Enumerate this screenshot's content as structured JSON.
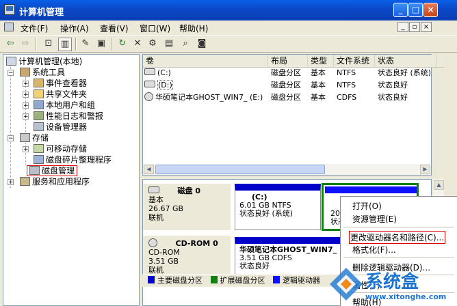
{
  "window": {
    "title": "计算机管理",
    "min": "_",
    "max": "□",
    "close": "×"
  },
  "menu": [
    "文件(F)",
    "操作(A)",
    "查看(V)",
    "窗口(W)",
    "帮助(H)"
  ],
  "mdi": {
    "min": "_",
    "restore": "▫",
    "close": "×"
  },
  "tree": {
    "root": "计算机管理(本地)",
    "system_tools": "系统工具",
    "event_viewer": "事件查看器",
    "shared_folders": "共享文件夹",
    "local_users": "本地用户和组",
    "perf_logs": "性能日志和警报",
    "device_manager": "设备管理器",
    "storage": "存储",
    "removable": "可移动存储",
    "defrag": "磁盘碎片整理程序",
    "disk_mgmt": "磁盘管理",
    "services": "服务和应用程序"
  },
  "list": {
    "headers": [
      "卷",
      "布局",
      "类型",
      "文件系统",
      "状态"
    ],
    "rows": [
      {
        "vol": "(C:)",
        "layout": "磁盘分区",
        "type": "基本",
        "fs": "NTFS",
        "status": "状态良好 (系统)"
      },
      {
        "vol": "(D:)",
        "layout": "磁盘分区",
        "type": "基本",
        "fs": "NTFS",
        "status": "状态良好"
      },
      {
        "vol": "华硕笔记本GHOST_WIN7_ (E:)",
        "layout": "磁盘分区",
        "type": "基本",
        "fs": "CDFS",
        "status": "状态良好"
      }
    ]
  },
  "disks": [
    {
      "name": "磁盘 0",
      "kind": "基本",
      "size": "26.67 GB",
      "state": "联机",
      "parts": [
        {
          "label": "(C:)",
          "detail": "6.01 GB NTFS",
          "status": "状态良好 (系统)"
        },
        {
          "label": "20.",
          "status": "状态"
        }
      ]
    },
    {
      "name": "CD-ROM 0",
      "kind": "CD-ROM",
      "size": "3.51 GB",
      "state": "联机",
      "parts": [
        {
          "label": "华硕笔记本GHOST_WIN7_",
          "detail": "3.51 GB CDFS",
          "status": "状态良好"
        }
      ]
    }
  ],
  "legend": [
    "主要磁盘分区",
    "扩展磁盘分区",
    "逻辑驱动器"
  ],
  "context_menu": {
    "open": "打开(O)",
    "explore": "资源管理(E)",
    "change_letter": "更改驱动器名和路径(C)...",
    "format": "格式化(F)...",
    "delete": "删除逻辑驱动器(D)...",
    "properties": "属性(P)",
    "help": "帮助(H)"
  },
  "watermark": {
    "brand": "系统盒",
    "url": "www.xitonghe.com"
  },
  "colors": {
    "primary": "#0000c8",
    "extended": "#108010",
    "logical": "#1010ff",
    "title": "#0b4fd2"
  }
}
